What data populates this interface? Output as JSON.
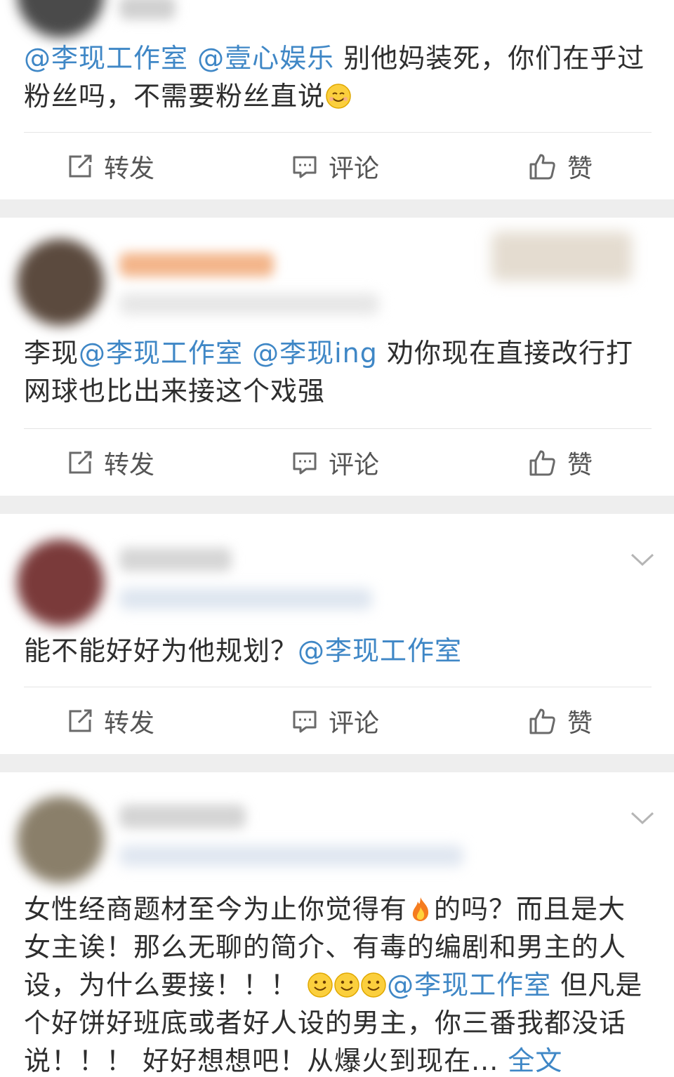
{
  "actions": {
    "repost_label": "转发",
    "comment_label": "评论",
    "like_label": "赞"
  },
  "posts": [
    {
      "segments": [
        {
          "text": "@李现工作室",
          "mention": true
        },
        {
          "text": " "
        },
        {
          "text": "@壹心娱乐",
          "mention": true
        },
        {
          "text": " 别他妈装死，你们在乎过粉丝吗，不需要粉丝直说"
        }
      ],
      "trailing_emoji": "smile-emoji"
    },
    {
      "segments": [
        {
          "text": "李现"
        },
        {
          "text": "@李现工作室",
          "mention": true
        },
        {
          "text": " "
        },
        {
          "text": "@李现ing",
          "mention": true
        },
        {
          "text": " 劝你现在直接改行打网球也比出来接这个戏强"
        }
      ]
    },
    {
      "segments": [
        {
          "text": "能不能好好为他规划？"
        },
        {
          "text": "@李现工作室",
          "mention": true
        }
      ]
    },
    {
      "segments": [
        {
          "text": "女性经商题材至今为止你觉得有"
        },
        {
          "emoji": "fire-emoji"
        },
        {
          "text": "的吗？而且是大女主诶！那么无聊的简介、有毒的编剧和男主的人设，为什么要接！！！ "
        },
        {
          "emoji": "smile-emoji"
        },
        {
          "emoji": "smile-emoji"
        },
        {
          "emoji": "smile-emoji"
        },
        {
          "text": "@李现工作室",
          "mention": true
        },
        {
          "text": "  但凡是个好饼好班底或者好人设的男主，你三番我都没话说！！！  好好想想吧！从爆火到现在..."
        },
        {
          "text": " 全文",
          "link": true
        }
      ]
    }
  ],
  "colors": {
    "mention": "#3f87c6",
    "text": "#2e2e2e",
    "action_text": "#555555",
    "separator": "#eeeeee"
  },
  "icons": {
    "repost": "repost-icon",
    "comment": "comment-icon",
    "like": "thumbs-up-icon",
    "more": "chevron-down-icon"
  }
}
